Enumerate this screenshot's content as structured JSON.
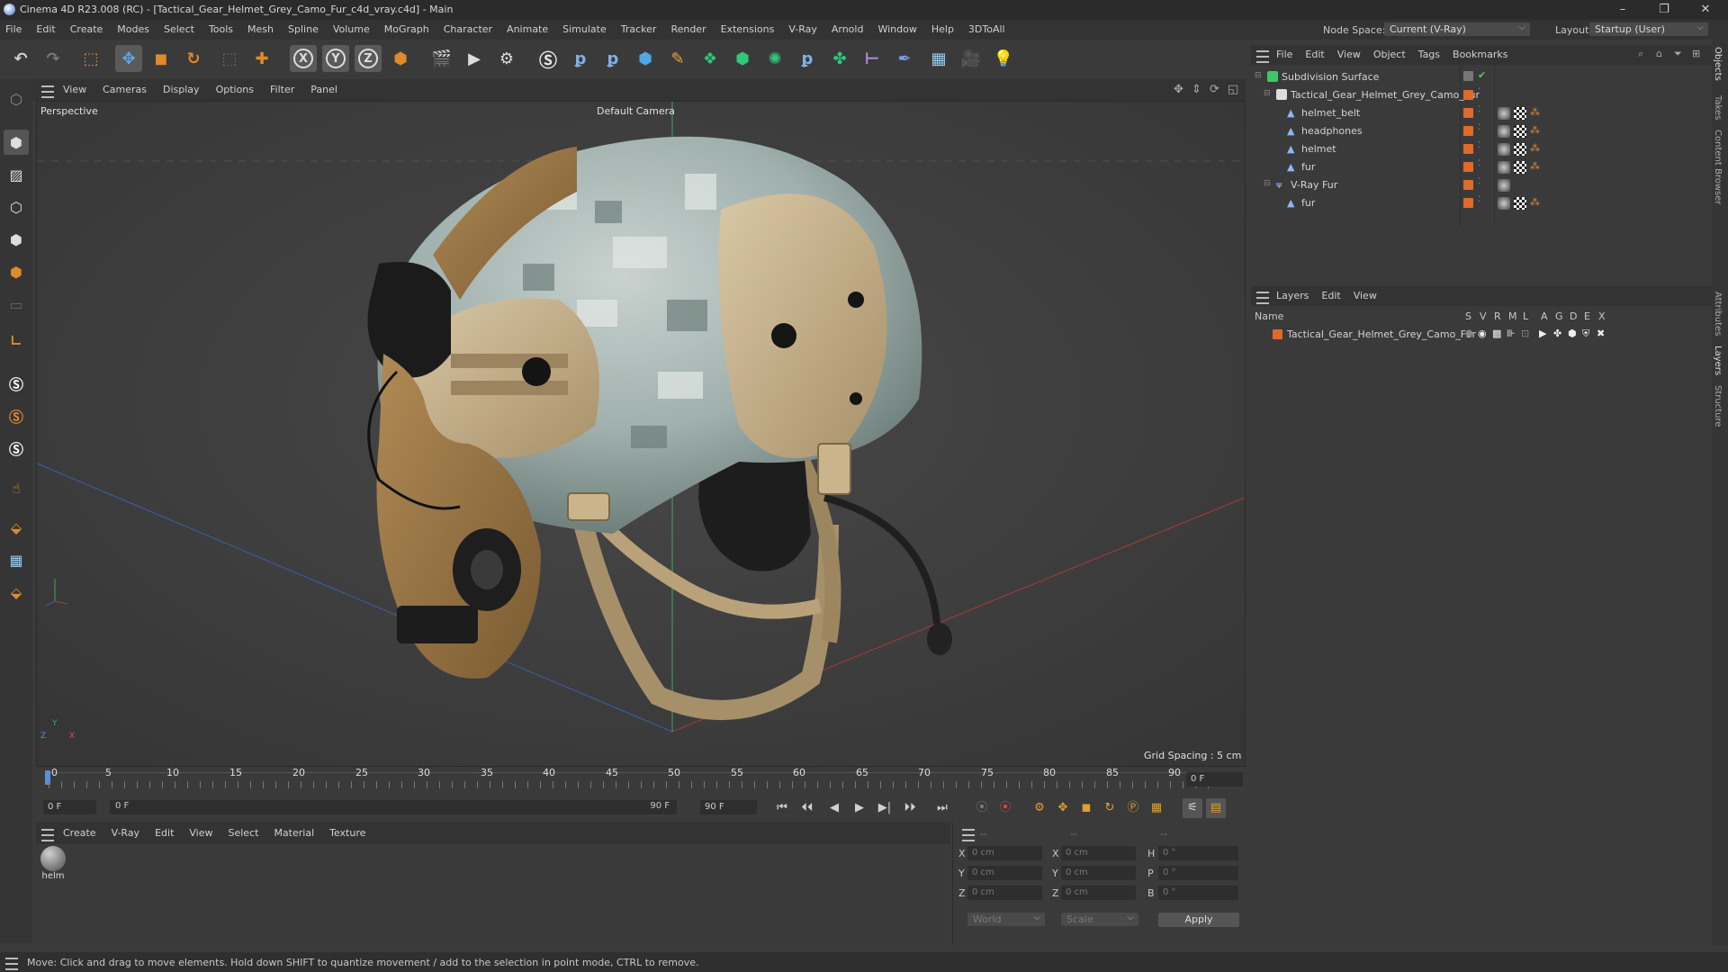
{
  "window": {
    "title": "Cinema 4D R23.008 (RC) - [Tactical_Gear_Helmet_Grey_Camo_Fur_c4d_vray.c4d] - Main",
    "controls": [
      "minimize",
      "restore",
      "close"
    ]
  },
  "menubar": {
    "items": [
      "File",
      "Edit",
      "Create",
      "Modes",
      "Select",
      "Tools",
      "Mesh",
      "Spline",
      "Volume",
      "MoGraph",
      "Character",
      "Animate",
      "Simulate",
      "Tracker",
      "Render",
      "Extensions",
      "V-Ray",
      "Arnold",
      "Window",
      "Help",
      "3DToAll"
    ],
    "node_space_label": "Node Space:",
    "node_space_value": "Current (V-Ray)",
    "layout_label": "Layout:",
    "layout_value": "Startup (User)"
  },
  "viewport": {
    "menu": [
      "View",
      "Cameras",
      "Display",
      "Options",
      "Filter",
      "Panel"
    ],
    "view_name": "Perspective",
    "camera": "Default Camera",
    "grid_spacing": "Grid Spacing : 5 cm",
    "axis_labels": {
      "y": "Y",
      "z": "Z",
      "x": "X"
    }
  },
  "timeline": {
    "ticks": [
      "0",
      "5",
      "10",
      "15",
      "20",
      "25",
      "30",
      "35",
      "40",
      "45",
      "50",
      "55",
      "60",
      "65",
      "70",
      "75",
      "80",
      "85",
      "90"
    ],
    "current_frame_right": "0 F"
  },
  "transport": {
    "start_field": "0 F",
    "range_start": "0 F",
    "range_end": "90 F",
    "end_field": "90 F"
  },
  "material_manager": {
    "menu": [
      "Create",
      "V-Ray",
      "Edit",
      "View",
      "Select",
      "Material",
      "Texture"
    ],
    "materials": [
      {
        "label": "helm"
      }
    ]
  },
  "coordinates": {
    "header": [
      "--",
      "--",
      "--"
    ],
    "rows": [
      {
        "a_label": "X",
        "a_value": "0 cm",
        "b_label": "X",
        "b_value": "0 cm",
        "c_label": "H",
        "c_value": "0 °"
      },
      {
        "a_label": "Y",
        "a_value": "0 cm",
        "b_label": "Y",
        "b_value": "0 cm",
        "c_label": "P",
        "c_value": "0 °"
      },
      {
        "a_label": "Z",
        "a_value": "0 cm",
        "b_label": "Z",
        "b_value": "0 cm",
        "c_label": "B",
        "c_value": "0 °"
      }
    ],
    "mode": "World",
    "transform": "Scale",
    "apply_label": "Apply"
  },
  "object_manager": {
    "menu": [
      "File",
      "Edit",
      "View",
      "Object",
      "Tags",
      "Bookmarks"
    ],
    "objects": [
      {
        "name": "Subdivision Surface"
      },
      {
        "name": "Tactical_Gear_Helmet_Grey_Camo_Fur"
      },
      {
        "name": "helmet_belt"
      },
      {
        "name": "headphones"
      },
      {
        "name": "helmet"
      },
      {
        "name": "fur"
      },
      {
        "name": "V-Ray Fur"
      },
      {
        "name": "fur"
      }
    ]
  },
  "layer_manager": {
    "menu": [
      "Layers",
      "Edit",
      "View"
    ],
    "name_header": "Name",
    "column_headers": [
      "S",
      "V",
      "R",
      "M",
      "L",
      "A",
      "G",
      "D",
      "E",
      "X"
    ],
    "layers": [
      {
        "name": "Tactical_Gear_Helmet_Grey_Camo_Fur"
      }
    ]
  },
  "right_tabs": [
    "Objects",
    "Takes",
    "Content Browser",
    "Attributes",
    "Layers",
    "Structure"
  ],
  "status_bar": {
    "text": "Move: Click and drag to move elements. Hold down SHIFT to quantize movement / add to the selection in point mode, CTRL to remove."
  },
  "colors": {
    "accent_orange": "#e06a2a",
    "selected_blue": "#5b8fd6",
    "green_check": "#5cc85c"
  }
}
